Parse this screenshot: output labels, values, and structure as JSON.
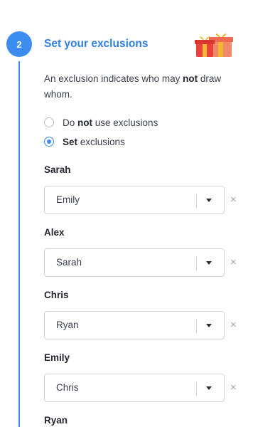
{
  "step": {
    "number": "2",
    "title": "Set your exclusions",
    "icon": "gift-icon"
  },
  "description": {
    "part1": "An exclusion indicates who may ",
    "bold": "not",
    "part2": " draw whom."
  },
  "radios": {
    "option1": {
      "pre": "Do ",
      "bold": "not",
      "post": " use exclusions",
      "checked": false
    },
    "option2": {
      "bold": "Set",
      "post": " exclusions",
      "checked": true
    }
  },
  "people": [
    {
      "name": "Sarah",
      "excluded": "Emily"
    },
    {
      "name": "Alex",
      "excluded": "Sarah"
    },
    {
      "name": "Chris",
      "excluded": "Ryan"
    },
    {
      "name": "Emily",
      "excluded": "Chris"
    },
    {
      "name": "Ryan"
    }
  ],
  "remove_symbol": "×",
  "colors": {
    "accent": "#3d8cf0",
    "title": "#2e80e6",
    "gift_red": "#e8433a",
    "gift_ribbon": "#f2b632"
  }
}
